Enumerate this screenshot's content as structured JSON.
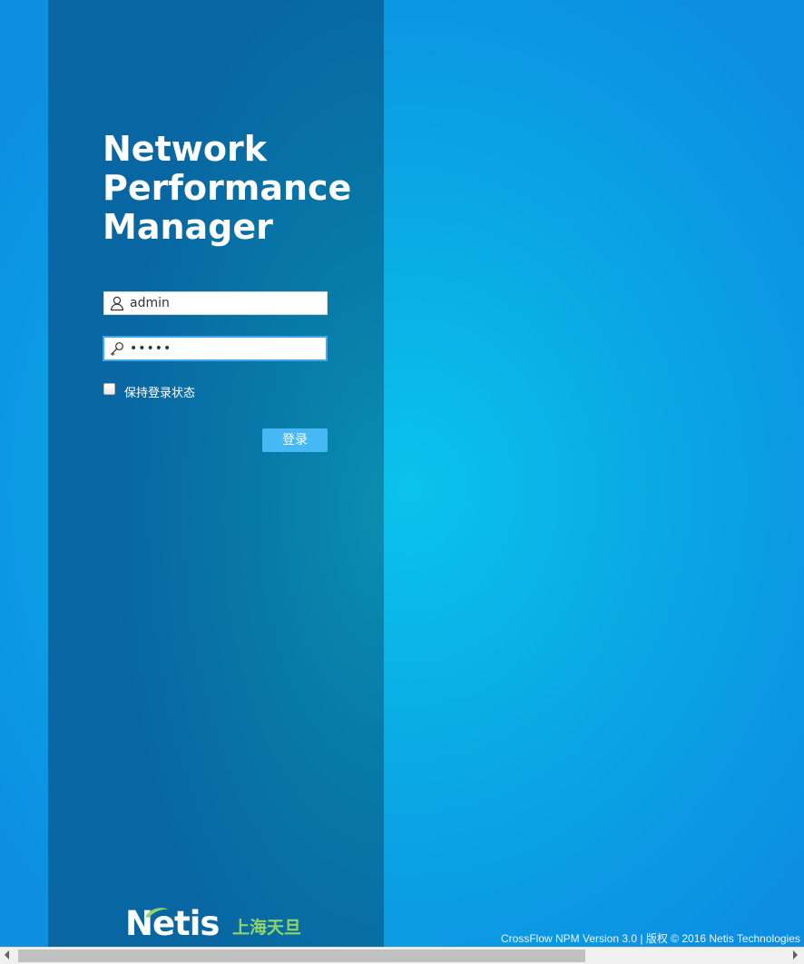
{
  "app": {
    "title_lines": [
      "Network",
      "Performance",
      "Manager"
    ]
  },
  "login": {
    "username_value": "admin",
    "password_value": "•••••",
    "remember_label": "保持登录状态",
    "remember_checked": false,
    "submit_label": "登录"
  },
  "branding": {
    "logo_text": "Netis",
    "logo_cn": "上海天旦"
  },
  "footer": {
    "copyright": "CrossFlow NPM Version 3.0 | 版权 © 2016 Netis Technologies"
  },
  "icons": {
    "username_icon": "user-icon",
    "password_icon": "key-icon"
  },
  "colors": {
    "page_bg": "#0ca3e6",
    "panel_bg": "#0874aa",
    "button_bg": "#46b8f4",
    "logo_cn": "#8fd36a",
    "focus_border": "#3ea6ea"
  }
}
